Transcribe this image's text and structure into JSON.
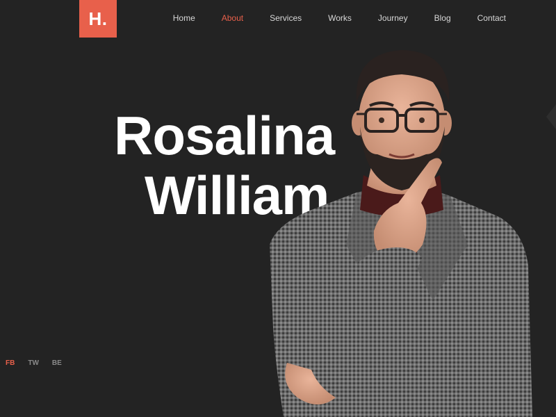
{
  "brand": {
    "logo_text": "H.",
    "accent": "#e8604b"
  },
  "nav": {
    "items": [
      {
        "label": "Home"
      },
      {
        "label": "About"
      },
      {
        "label": "Services"
      },
      {
        "label": "Works"
      },
      {
        "label": "Journey"
      },
      {
        "label": "Blog"
      },
      {
        "label": "Contact"
      }
    ],
    "active": "About"
  },
  "hero": {
    "first_name": "Rosalina",
    "last_name": "William"
  },
  "social": {
    "items": [
      {
        "label": "FB"
      },
      {
        "label": "TW"
      },
      {
        "label": "BE"
      }
    ],
    "active": "FB"
  },
  "colors": {
    "background": "#232323",
    "text": "#ffffff",
    "nav_text": "#d8d8d8",
    "social_text": "#8a8a8a"
  }
}
